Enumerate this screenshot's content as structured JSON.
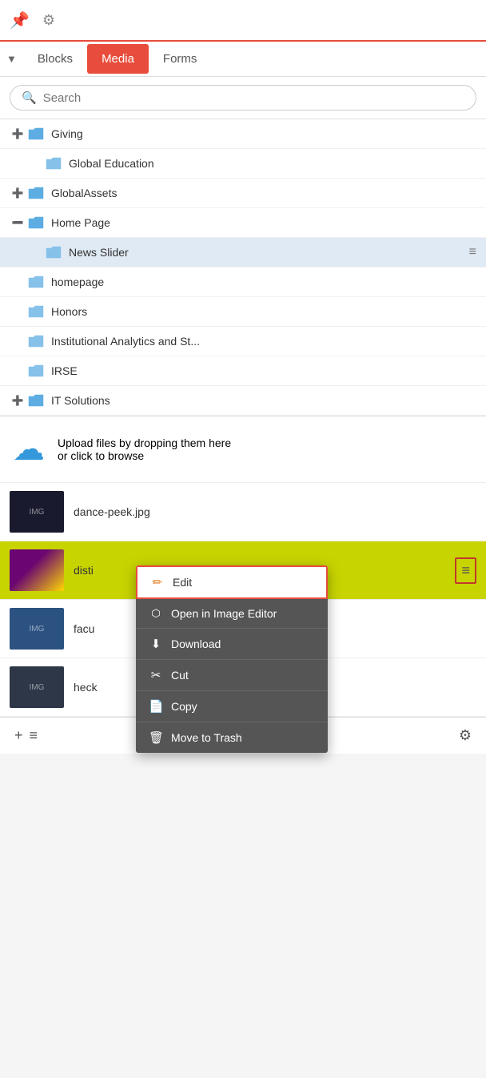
{
  "topbar": {
    "pin_icon": "📌",
    "gear_icon": "⚙"
  },
  "nav": {
    "arrow_label": "▼",
    "tabs": [
      {
        "id": "blocks",
        "label": "Blocks",
        "active": false
      },
      {
        "id": "media",
        "label": "Media",
        "active": true
      },
      {
        "id": "forms",
        "label": "Forms",
        "active": false
      }
    ]
  },
  "search": {
    "placeholder": "Search"
  },
  "folders": [
    {
      "id": "giving",
      "label": "Giving",
      "expandable": true,
      "expanded": false,
      "indent": 0
    },
    {
      "id": "global-education",
      "label": "Global Education",
      "expandable": false,
      "expanded": false,
      "indent": 1
    },
    {
      "id": "global-assets",
      "label": "GlobalAssets",
      "expandable": true,
      "expanded": false,
      "indent": 0
    },
    {
      "id": "home-page",
      "label": "Home Page",
      "expandable": true,
      "expanded": true,
      "indent": 0
    },
    {
      "id": "news-slider",
      "label": "News Slider",
      "expandable": false,
      "expanded": false,
      "indent": 1,
      "selected": true,
      "has_menu": true
    },
    {
      "id": "homepage",
      "label": "homepage",
      "expandable": false,
      "expanded": false,
      "indent": 0
    },
    {
      "id": "honors",
      "label": "Honors",
      "expandable": false,
      "expanded": false,
      "indent": 0
    },
    {
      "id": "institutional",
      "label": "Institutional Analytics and St...",
      "expandable": false,
      "expanded": false,
      "indent": 0
    },
    {
      "id": "irse",
      "label": "IRSE",
      "expandable": false,
      "expanded": false,
      "indent": 0
    },
    {
      "id": "it-solutions",
      "label": "IT Solutions",
      "expandable": true,
      "expanded": false,
      "indent": 0
    }
  ],
  "upload": {
    "icon": "☁",
    "text_line1": "Upload files by dropping them here",
    "text_line2": "or click to browse"
  },
  "files": [
    {
      "id": "dance-peek",
      "name": "dance-peek.jpg",
      "thumb_bg": "#1a1a2e",
      "highlighted": false
    },
    {
      "id": "disti",
      "name": "disti",
      "thumb_bg": "#6a1a6a",
      "highlighted": true,
      "has_context": true
    },
    {
      "id": "facu",
      "name": "facu",
      "thumb_bg": "#2c5282",
      "highlighted": false
    },
    {
      "id": "heck",
      "name": "heck",
      "thumb_bg": "#2d3748",
      "highlighted": false
    }
  ],
  "context_menu": {
    "items": [
      {
        "id": "edit",
        "label": "Edit",
        "icon": "✏",
        "is_edit": true
      },
      {
        "id": "open-image-editor",
        "label": "Open in Image Editor",
        "icon": "⬡"
      },
      {
        "id": "download",
        "label": "Download",
        "icon": "⬇"
      },
      {
        "id": "cut",
        "label": "Cut",
        "icon": "✂"
      },
      {
        "id": "copy",
        "label": "Copy",
        "icon": "📄"
      },
      {
        "id": "move-to-trash",
        "label": "Move to Trash",
        "icon": "🗑"
      }
    ]
  },
  "bottom_toolbar": {
    "add_icon": "+",
    "menu_icon": "≡",
    "gear_icon": "⚙"
  }
}
